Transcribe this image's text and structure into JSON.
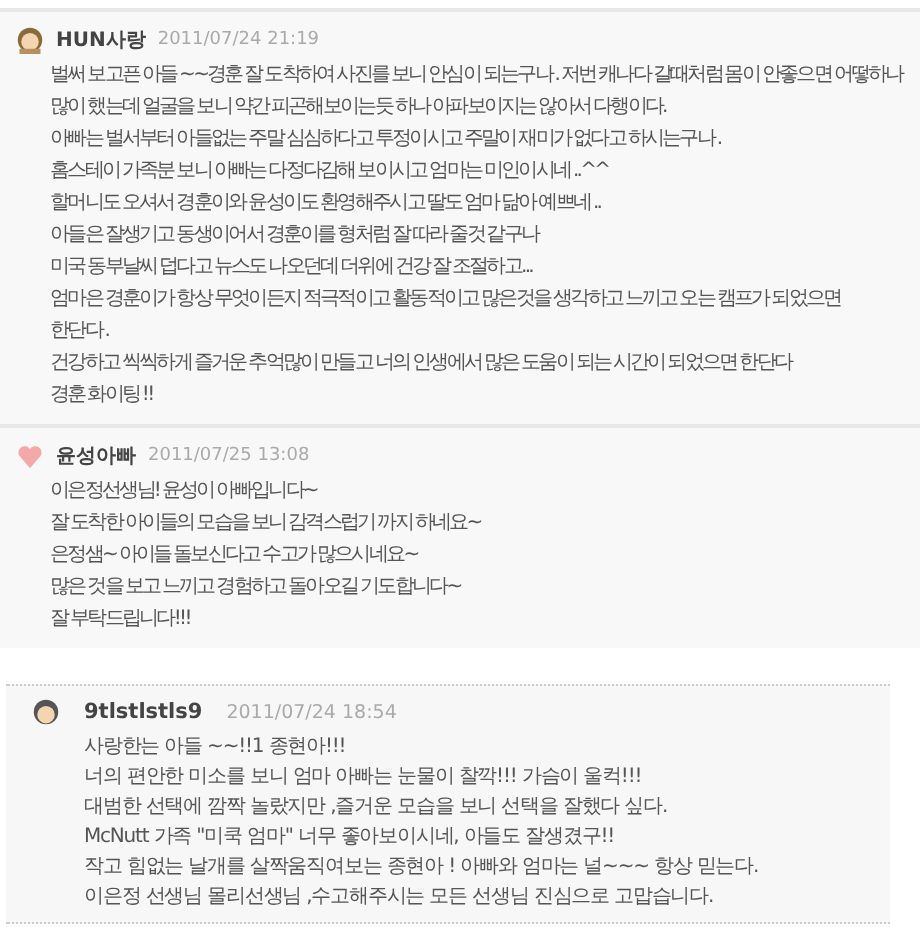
{
  "comments": [
    {
      "author": "HUN사랑",
      "date": "2011/07/24 21:19",
      "kind": "woman",
      "boxed": false,
      "lines": [
        "벌써 보고픈 아들 ~~경훈 잘 도착하여 사진를 보니 안심이 되는구나 . 저번 캐나다 갈때처럼 몸이 안좋으면 어떻하나",
        "많이 했는데 얼굴을 보니 약간 피곤해보이는듯 하나 아파보이지는 않아서 다행이다.",
        "아빠는 벌서부터 아들없는 주말 심심하다고 투정이시고 주말이 재미가 없다고 하시는구나 .",
        "홈스테이 가족분 보니 아빠는 다정다감해 보이시고 엄마는 미인이시네 ..^^",
        "할머니도 오셔서 경훈이와 윤성이도 환영해주시고 딸도 엄마 닮아 예쁘네 ..",
        "아들은 잘생기고 동생이어서 경훈이를 형처럼 잘 따라 줄것 같구나",
        "미국 동부날씨 덥다고 뉴스도 나오던데 더위에 건강 잘 조절하고...",
        "엄마은 경훈이가 항상 무엇이든지 적극적이고 활동적이고 많은것을 생각하고 느끼고 오는 캠프가 되었으면",
        "한단다 .",
        "건강하고 씩씩하게 즐거운 추억많이 만들고 너의 인생에서 많은 도움이 되는 시간이 되었으면 한단다",
        "경훈 화이팅 !!"
      ]
    },
    {
      "author": "윤성아빠",
      "date": "2011/07/25 13:08",
      "kind": "heart",
      "boxed": false,
      "lines": [
        "이은정선생님! 윤성이 아빠입니다~",
        "잘 도착한 아이들의 모습을 보니 감격스럽기 까지 하네요~",
        "은정샘~ 아이들 돌보신다고 수고가 많으시네요~",
        "많은 것을 보고 느끼고 경험하고 돌아오길 기도합니다~",
        "잘 부탁드립니다!!!"
      ]
    },
    {
      "author": "9tlstlstls9",
      "date": "2011/07/24 18:54",
      "kind": "man",
      "boxed": true,
      "lines": [
        "사랑한는 아들 ~~!!1 종현아!!!",
        "너의 편안한 미소를 보니 엄마 아빠는 눈물이 찰깍!!! 가슴이 울컥!!!",
        "대범한 선택에 깜짝 놀랐지만 ,즐거운 모습을 보니 선택을 잘했다 싶다.",
        "McNutt 가족 \"미쿡 엄마\" 너무 좋아보이시네, 아들도 잘생겼구!!",
        "작고 힘없는 날개를 살짝움직여보는 종현아 ! 아빠와 엄마는 널~~~ 항상 믿는다.",
        "이은정 선생님 몰리선생님 ,수고해주시는 모든 선생님 진심으로 고맙습니다."
      ]
    }
  ]
}
